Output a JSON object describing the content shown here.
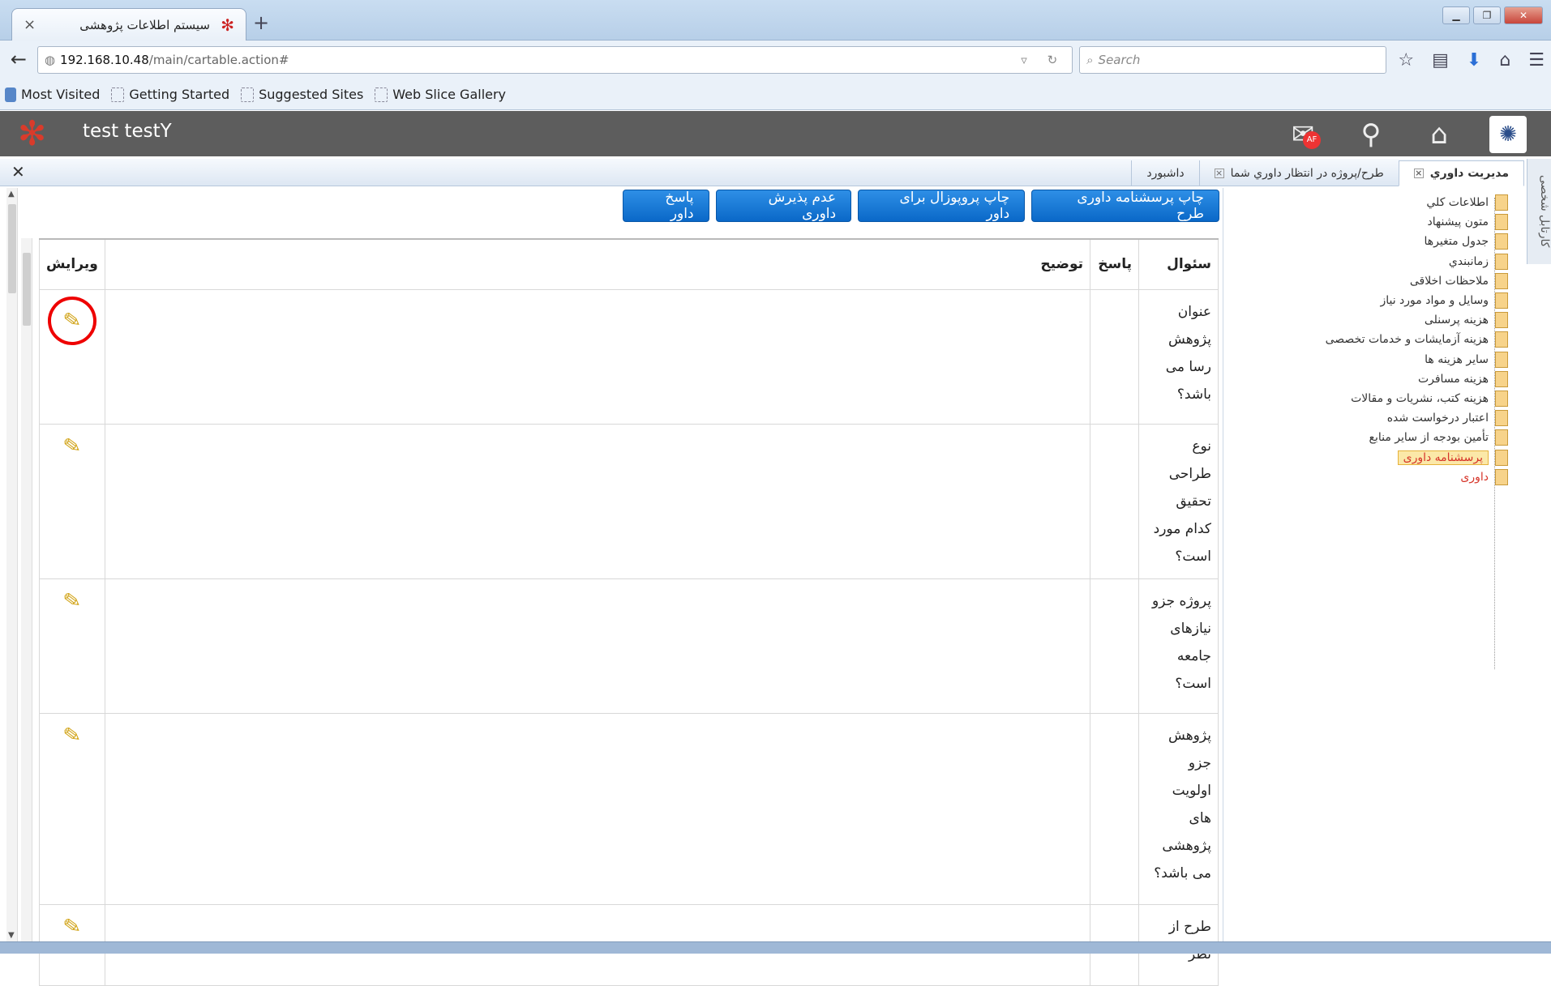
{
  "browser": {
    "tab_title": "سیستم اطلاعات پژوهشی",
    "tab_close": "×",
    "new_tab": "+",
    "url_host": "192.168.10.48",
    "url_path": "/main/cartable.action#",
    "search_placeholder": "Search",
    "bookmarks": [
      "Most Visited",
      "Getting Started",
      "Suggested Sites",
      "Web Slice Gallery"
    ]
  },
  "app": {
    "user_name": "test testY",
    "mail_badge": "AF"
  },
  "tabs": [
    {
      "label": "داشبورد"
    },
    {
      "label": "طرح/پروژه در انتظار داوري شما"
    },
    {
      "label": "مديريت داوري",
      "active": true
    }
  ],
  "vertical_tab": "کارتابل شخصی",
  "sidebar": {
    "items": [
      "اطلاعات کلي",
      "متون پیشنهاد",
      "جدول متغیرها",
      "زمانبندي",
      "ملاحظات اخلاقی",
      "وسایل و مواد مورد نیاز",
      "هزینه پرسنلی",
      "هزینه آزمایشات و خدمات تخصصی",
      "سایر هزینه ها",
      "هزینه مسافرت",
      "هزینه کتب، نشریات و مقالات",
      "اعتبار درخواست شده",
      "تأمین بودجه از سایر منابع",
      "پرسشنامه داوری",
      "داوری"
    ]
  },
  "toolbar": {
    "buttons": [
      "پاسخ داور",
      "عدم پذیرش داوری",
      "چاپ پروپوزال برای داور",
      "چاپ پرسشنامه داوری طرح"
    ]
  },
  "table": {
    "headers": {
      "question": "سئوال",
      "answer": "پاسخ",
      "description": "توضیح",
      "edit": "ویرایش"
    },
    "rows": [
      {
        "question": "عنوان پژوهش رسا می باشد؟",
        "answer": "",
        "description": ""
      },
      {
        "question": "نوع طراحی تحقیق کدام مورد است؟",
        "answer": "",
        "description": ""
      },
      {
        "question": "پروژه جزو نیازهای جامعه است؟",
        "answer": "",
        "description": ""
      },
      {
        "question": "پژوهش جزو اولویت های پژوهشی می باشد؟",
        "answer": "",
        "description": ""
      },
      {
        "question": "طرح از نظر",
        "answer": "",
        "description": ""
      }
    ]
  },
  "colors": {
    "button": "#0a68c8",
    "header_bar": "#5d5d5d",
    "highlight_circle": "#e00000"
  }
}
